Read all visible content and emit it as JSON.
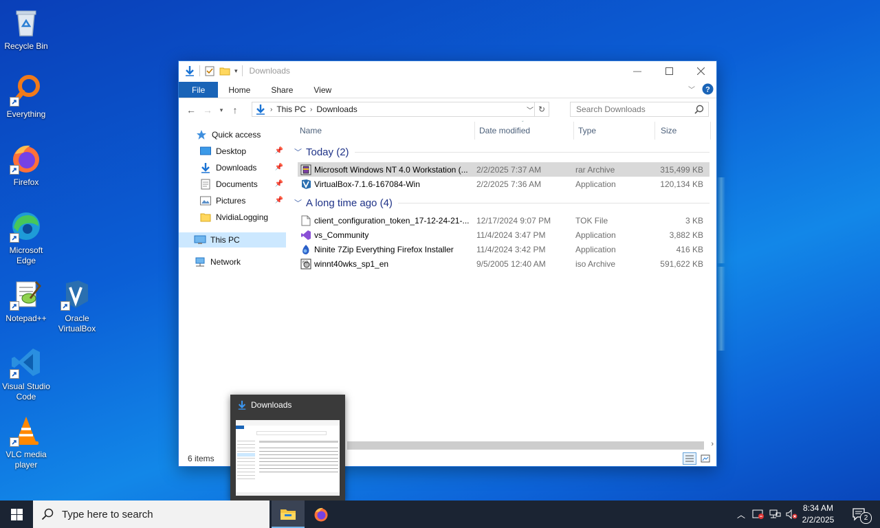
{
  "desktop": {
    "icons": [
      {
        "label": "Recycle Bin"
      },
      {
        "label": "Everything"
      },
      {
        "label": "Firefox"
      },
      {
        "label": "Microsoft Edge"
      },
      {
        "label": "Notepad++"
      },
      {
        "label": "Oracle VirtualBox"
      },
      {
        "label": "Visual Studio Code"
      },
      {
        "label": "VLC media player"
      }
    ]
  },
  "window": {
    "title": "Downloads",
    "ribbon_tabs": [
      "File",
      "Home",
      "Share",
      "View"
    ],
    "address": {
      "root": "This PC",
      "folder": "Downloads"
    },
    "search_placeholder": "Search Downloads",
    "nav": {
      "quick_access": "Quick access",
      "items": [
        "Desktop",
        "Downloads",
        "Documents",
        "Pictures",
        "NvidiaLogging"
      ],
      "this_pc": "This PC",
      "network": "Network"
    },
    "columns": {
      "name": "Name",
      "date": "Date modified",
      "type": "Type",
      "size": "Size"
    },
    "groups": [
      {
        "label": "Today (2)",
        "files": [
          {
            "name": "Microsoft Windows NT 4.0 Workstation (...",
            "date": "2/2/2025 7:37 AM",
            "type": "rar Archive",
            "size": "315,499 KB",
            "icon": "archive-icon",
            "selected": true
          },
          {
            "name": "VirtualBox-7.1.6-167084-Win",
            "date": "2/2/2025 7:36 AM",
            "type": "Application",
            "size": "120,134 KB",
            "icon": "virtualbox-icon"
          }
        ]
      },
      {
        "label": "A long time ago (4)",
        "files": [
          {
            "name": "client_configuration_token_17-12-24-21-...",
            "date": "12/17/2024 9:07 PM",
            "type": "TOK File",
            "size": "3 KB",
            "icon": "file-icon"
          },
          {
            "name": "vs_Community",
            "date": "11/4/2024 3:47 PM",
            "type": "Application",
            "size": "3,882 KB",
            "icon": "visual-studio-icon"
          },
          {
            "name": "Ninite 7Zip Everything Firefox Installer",
            "date": "11/4/2024 3:42 PM",
            "type": "Application",
            "size": "416 KB",
            "icon": "ninite-icon"
          },
          {
            "name": "winnt40wks_sp1_en",
            "date": "9/5/2005 12:40 AM",
            "type": "iso Archive",
            "size": "591,622 KB",
            "icon": "iso-icon"
          }
        ]
      }
    ],
    "status": "6 items"
  },
  "preview": {
    "title": "Downloads"
  },
  "taskbar": {
    "search_placeholder": "Type here to search",
    "time": "8:34 AM",
    "date": "2/2/2025",
    "notification_count": "2"
  },
  "colors": {
    "accent": "#1a64b7",
    "selection": "#cce8ff",
    "taskbar": "#1b2433"
  }
}
